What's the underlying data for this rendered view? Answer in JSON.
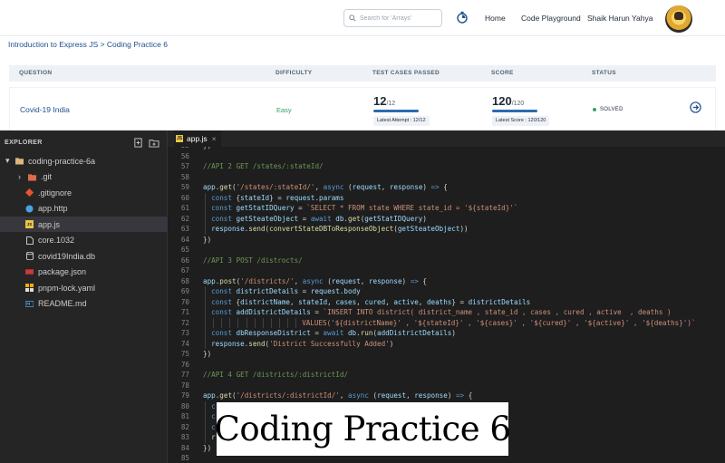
{
  "nav": {
    "search_placeholder": "Search for 'Arrays'",
    "home": "Home",
    "playground": "Code Playground",
    "user": "Shaik Harun Yahya"
  },
  "breadcrumb": "Introduction to Express JS > Coding Practice 6",
  "table": {
    "headers": [
      "QUESTION",
      "DIFFICULTY",
      "TEST CASES PASSED",
      "SCORE",
      "STATUS"
    ],
    "row": {
      "question": "Covid-19 India",
      "difficulty": "Easy",
      "tests_passed": "12",
      "tests_total": "/12",
      "tests_fraction": 1.0,
      "latest_attempt": "Latest Attempt : 12/12",
      "score": "120",
      "score_total": "/120",
      "score_fraction": 1.0,
      "latest_score": "Latest Score : 120/120",
      "status": "SOLVED"
    }
  },
  "editor": {
    "explorer_title": "EXPLORER",
    "tab": "app.js",
    "tree": [
      {
        "label": "coding-practice-6a",
        "icon": "folder-open-icon"
      },
      {
        "label": ".git",
        "icon": "git-folder-icon"
      },
      {
        "label": ".gitignore",
        "icon": "git-file-icon"
      },
      {
        "label": "app.http",
        "icon": "http-file-icon"
      },
      {
        "label": "app.js",
        "icon": "js-file-icon"
      },
      {
        "label": "core.1032",
        "icon": "file-icon"
      },
      {
        "label": "covid19India.db",
        "icon": "database-icon"
      },
      {
        "label": "package.json",
        "icon": "npm-icon"
      },
      {
        "label": "pnpm-lock.yaml",
        "icon": "pnpm-icon"
      },
      {
        "label": "README.md",
        "icon": "markdown-icon"
      }
    ],
    "lines": [
      {
        "n": "55",
        "indent": 0,
        "t": [
          [
            "p",
            "})"
          ]
        ]
      },
      {
        "n": "56",
        "indent": 0,
        "t": []
      },
      {
        "n": "57",
        "indent": 0,
        "t": [
          [
            "c",
            "//API 2 GET /states/:stateId/"
          ]
        ]
      },
      {
        "n": "58",
        "indent": 0,
        "t": []
      },
      {
        "n": "59",
        "indent": 0,
        "t": [
          [
            "v",
            "app"
          ],
          [
            "p",
            "."
          ],
          [
            "f",
            "get"
          ],
          [
            "p",
            "("
          ],
          [
            "s",
            "'/states/:stateId/'"
          ],
          [
            "p",
            ", "
          ],
          [
            "k",
            "async"
          ],
          [
            "p",
            " ("
          ],
          [
            "v",
            "request"
          ],
          [
            "p",
            ", "
          ],
          [
            "v",
            "response"
          ],
          [
            "p",
            ") "
          ],
          [
            "k",
            "=>"
          ],
          [
            "p",
            " {"
          ]
        ]
      },
      {
        "n": "60",
        "indent": 1,
        "t": [
          [
            "k",
            "const"
          ],
          [
            "p",
            " {"
          ],
          [
            "v",
            "stateId"
          ],
          [
            "p",
            "} = "
          ],
          [
            "v",
            "request"
          ],
          [
            "p",
            "."
          ],
          [
            "v",
            "params"
          ]
        ]
      },
      {
        "n": "61",
        "indent": 1,
        "t": [
          [
            "k",
            "const"
          ],
          [
            "p",
            " "
          ],
          [
            "v",
            "getStatIDQuery"
          ],
          [
            "p",
            " = "
          ],
          [
            "s",
            "`SELECT * FROM state WHERE state_id = '${stateId}'`"
          ]
        ]
      },
      {
        "n": "62",
        "indent": 1,
        "t": [
          [
            "k",
            "const"
          ],
          [
            "p",
            " "
          ],
          [
            "v",
            "getSteateObject"
          ],
          [
            "p",
            " = "
          ],
          [
            "k",
            "await"
          ],
          [
            "p",
            " "
          ],
          [
            "v",
            "db"
          ],
          [
            "p",
            "."
          ],
          [
            "f",
            "get"
          ],
          [
            "p",
            "("
          ],
          [
            "v",
            "getStatIDQuery"
          ],
          [
            "p",
            ")"
          ]
        ]
      },
      {
        "n": "63",
        "indent": 1,
        "t": [
          [
            "v",
            "response"
          ],
          [
            "p",
            "."
          ],
          [
            "f",
            "send"
          ],
          [
            "p",
            "("
          ],
          [
            "f",
            "convertStateDBToResponseObject"
          ],
          [
            "p",
            "("
          ],
          [
            "v",
            "getSteateObject"
          ],
          [
            "p",
            "))"
          ]
        ]
      },
      {
        "n": "64",
        "indent": 0,
        "t": [
          [
            "p",
            "})"
          ]
        ]
      },
      {
        "n": "65",
        "indent": 0,
        "t": []
      },
      {
        "n": "66",
        "indent": 0,
        "t": [
          [
            "c",
            "//API 3 POST /distrocts/"
          ]
        ]
      },
      {
        "n": "67",
        "indent": 0,
        "t": []
      },
      {
        "n": "68",
        "indent": 0,
        "t": [
          [
            "v",
            "app"
          ],
          [
            "p",
            "."
          ],
          [
            "f",
            "post"
          ],
          [
            "p",
            "("
          ],
          [
            "s",
            "'/districts/'"
          ],
          [
            "p",
            ", "
          ],
          [
            "k",
            "async"
          ],
          [
            "p",
            " ("
          ],
          [
            "v",
            "request"
          ],
          [
            "p",
            ", "
          ],
          [
            "v",
            "response"
          ],
          [
            "p",
            ") "
          ],
          [
            "k",
            "=>"
          ],
          [
            "p",
            " {"
          ]
        ]
      },
      {
        "n": "69",
        "indent": 1,
        "t": [
          [
            "k",
            "const"
          ],
          [
            "p",
            " "
          ],
          [
            "v",
            "districtDetails"
          ],
          [
            "p",
            " = "
          ],
          [
            "v",
            "request"
          ],
          [
            "p",
            "."
          ],
          [
            "v",
            "body"
          ]
        ]
      },
      {
        "n": "70",
        "indent": 1,
        "t": [
          [
            "k",
            "const"
          ],
          [
            "p",
            " {"
          ],
          [
            "v",
            "districtName"
          ],
          [
            "p",
            ", "
          ],
          [
            "v",
            "stateId"
          ],
          [
            "p",
            ", "
          ],
          [
            "v",
            "cases"
          ],
          [
            "p",
            ", "
          ],
          [
            "v",
            "cured"
          ],
          [
            "p",
            ", "
          ],
          [
            "v",
            "active"
          ],
          [
            "p",
            ", "
          ],
          [
            "v",
            "deaths"
          ],
          [
            "p",
            "} = "
          ],
          [
            "v",
            "districtDetails"
          ]
        ]
      },
      {
        "n": "71",
        "indent": 1,
        "t": [
          [
            "k",
            "const"
          ],
          [
            "p",
            " "
          ],
          [
            "v",
            "addDistrictDetails"
          ],
          [
            "p",
            " = "
          ],
          [
            "s",
            "`INSERT INTO district( district_name , state_id , cases , cured , active  , deaths )"
          ]
        ]
      },
      {
        "n": "72",
        "indent": 12,
        "t": [
          [
            "s",
            "VALUES('${districtName}' , '${stateId}' , '${cases}' , '${cured}' , '${active}' , '${deaths}')`"
          ]
        ]
      },
      {
        "n": "73",
        "indent": 1,
        "t": [
          [
            "k",
            "const"
          ],
          [
            "p",
            " "
          ],
          [
            "v",
            "dbResponseDistrict"
          ],
          [
            "p",
            " = "
          ],
          [
            "k",
            "await"
          ],
          [
            "p",
            " "
          ],
          [
            "v",
            "db"
          ],
          [
            "p",
            "."
          ],
          [
            "f",
            "run"
          ],
          [
            "p",
            "("
          ],
          [
            "v",
            "addDistrictDetails"
          ],
          [
            "p",
            ")"
          ]
        ]
      },
      {
        "n": "74",
        "indent": 1,
        "t": [
          [
            "v",
            "response"
          ],
          [
            "p",
            "."
          ],
          [
            "f",
            "send"
          ],
          [
            "p",
            "("
          ],
          [
            "s",
            "'District Successfully Added'"
          ],
          [
            "p",
            ")"
          ]
        ]
      },
      {
        "n": "75",
        "indent": 0,
        "t": [
          [
            "p",
            "})"
          ]
        ]
      },
      {
        "n": "76",
        "indent": 0,
        "t": []
      },
      {
        "n": "77",
        "indent": 0,
        "t": [
          [
            "c",
            "//API 4 GET /districts/:districtId/"
          ]
        ]
      },
      {
        "n": "78",
        "indent": 0,
        "t": []
      },
      {
        "n": "79",
        "indent": 0,
        "t": [
          [
            "v",
            "app"
          ],
          [
            "p",
            "."
          ],
          [
            "f",
            "get"
          ],
          [
            "p",
            "("
          ],
          [
            "s",
            "'/districts/:districtId/'"
          ],
          [
            "p",
            ", "
          ],
          [
            "k",
            "async"
          ],
          [
            "p",
            " ("
          ],
          [
            "v",
            "request"
          ],
          [
            "p",
            ", "
          ],
          [
            "v",
            "response"
          ],
          [
            "p",
            ") "
          ],
          [
            "k",
            "=>"
          ],
          [
            "p",
            " {"
          ]
        ]
      },
      {
        "n": "80",
        "indent": 1,
        "t": [
          [
            "k",
            "c"
          ]
        ]
      },
      {
        "n": "81",
        "indent": 1,
        "t": [
          [
            "k",
            "c"
          ],
          [
            "p",
            "                                       "
          ],
          [
            "s",
            "'${districtId}' ;`"
          ]
        ]
      },
      {
        "n": "82",
        "indent": 1,
        "t": [
          [
            "k",
            "c"
          ]
        ]
      },
      {
        "n": "83",
        "indent": 1,
        "t": [
          [
            "v",
            "r"
          ]
        ]
      },
      {
        "n": "84",
        "indent": 0,
        "t": [
          [
            "p",
            "})"
          ]
        ]
      },
      {
        "n": "85",
        "indent": 0,
        "t": []
      }
    ]
  },
  "overlay_title": "Coding Practice 6",
  "colors": {
    "accent": "#1f4e8c",
    "easy": "#36a167",
    "solved": "#36a167",
    "editor_bg": "#1e1e1e",
    "sidebar_bg": "#252526"
  }
}
